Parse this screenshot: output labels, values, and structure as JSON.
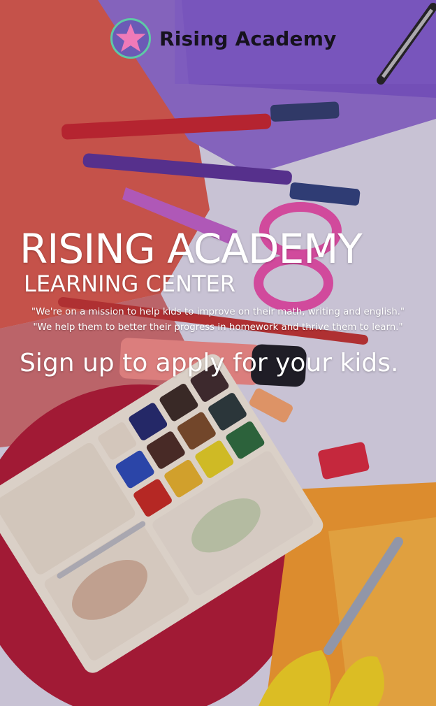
{
  "brand": {
    "name": "Rising Academy",
    "logo_icon": "star-icon",
    "logo_colors": {
      "star": "#f07ab8",
      "ring": "#5ec9a6",
      "fill": "#6b5ab6"
    }
  },
  "hero": {
    "title": "RISING ACADEMY",
    "subtitle": "LEARNING CENTER",
    "mission_lines": [
      "\"We're on a mission to help kids to improve on their math, writing and english.\"",
      "\"We help them to better their progress in homework and thrive them to learn.\""
    ],
    "cta": "Sign up to apply for your kids."
  },
  "background": {
    "image_subject": "school supplies: markers, scissors, watercolor paint palette, rulers on colorful paper"
  }
}
